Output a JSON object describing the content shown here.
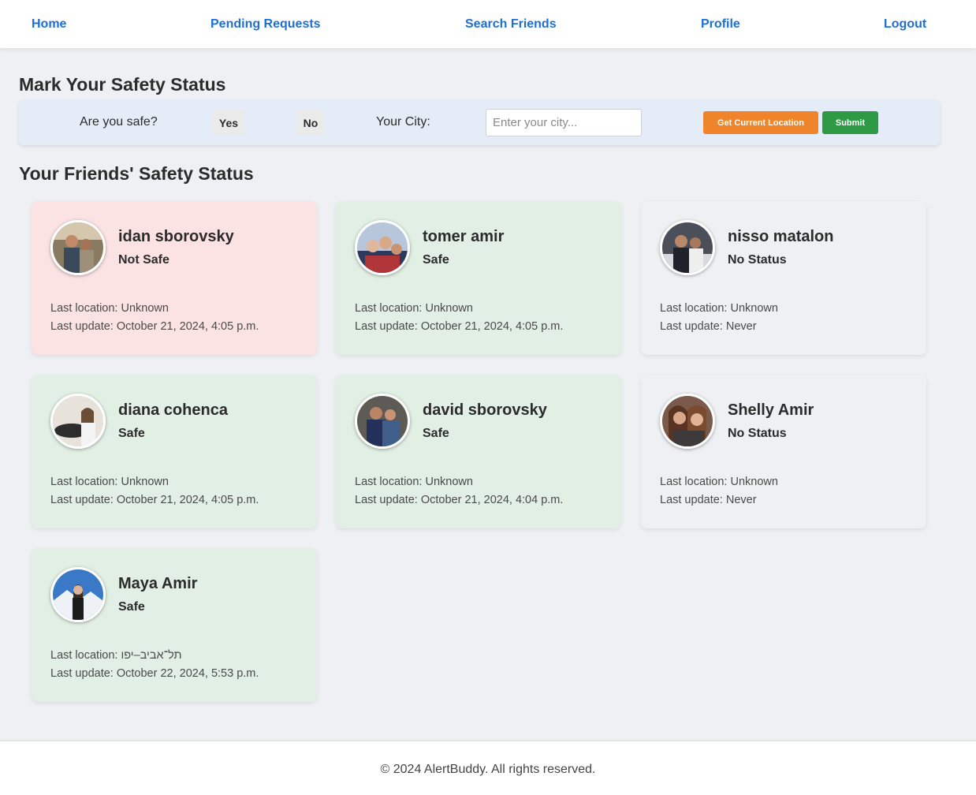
{
  "nav": {
    "home": "Home",
    "pending": "Pending Requests",
    "search": "Search Friends",
    "profile": "Profile",
    "logout": "Logout",
    "link_color": "#1d6fd6"
  },
  "safety_form": {
    "heading": "Mark Your Safety Status",
    "question": "Are you safe?",
    "yes": "Yes",
    "no": "No",
    "city_label": "Your City:",
    "city_placeholder": "Enter your city...",
    "city_value": "",
    "location_button": "Get Current Location",
    "submit_button": "Submit",
    "location_color": "#f0842a",
    "submit_color": "#2f9a46"
  },
  "friends": {
    "heading": "Your Friends' Safety Status",
    "location_prefix": "Last location: ",
    "update_prefix": "Last update: ",
    "status_colors": {
      "Not Safe": "#fbe3e4",
      "Safe": "#e1efe4",
      "No Status": "#eff0f3"
    },
    "items": [
      {
        "name": "idan sborovsky",
        "status": "Not Safe",
        "location": "Unknown",
        "updated": "October 21, 2024, 4:05 p.m."
      },
      {
        "name": "tomer amir",
        "status": "Safe",
        "location": "Unknown",
        "updated": "October 21, 2024, 4:05 p.m."
      },
      {
        "name": "nisso matalon",
        "status": "No Status",
        "location": "Unknown",
        "updated": "Never"
      },
      {
        "name": "diana cohenca",
        "status": "Safe",
        "location": "Unknown",
        "updated": "October 21, 2024, 4:05 p.m."
      },
      {
        "name": "david sborovsky",
        "status": "Safe",
        "location": "Unknown",
        "updated": "October 21, 2024, 4:04 p.m."
      },
      {
        "name": "Shelly Amir",
        "status": "No Status",
        "location": "Unknown",
        "updated": "Never"
      },
      {
        "name": "Maya Amir",
        "status": "Safe",
        "location": "תל־אביב–יפו",
        "updated": "October 22, 2024, 5:53 p.m."
      }
    ]
  },
  "footer": {
    "text": "© 2024 AlertBuddy. All rights reserved."
  }
}
